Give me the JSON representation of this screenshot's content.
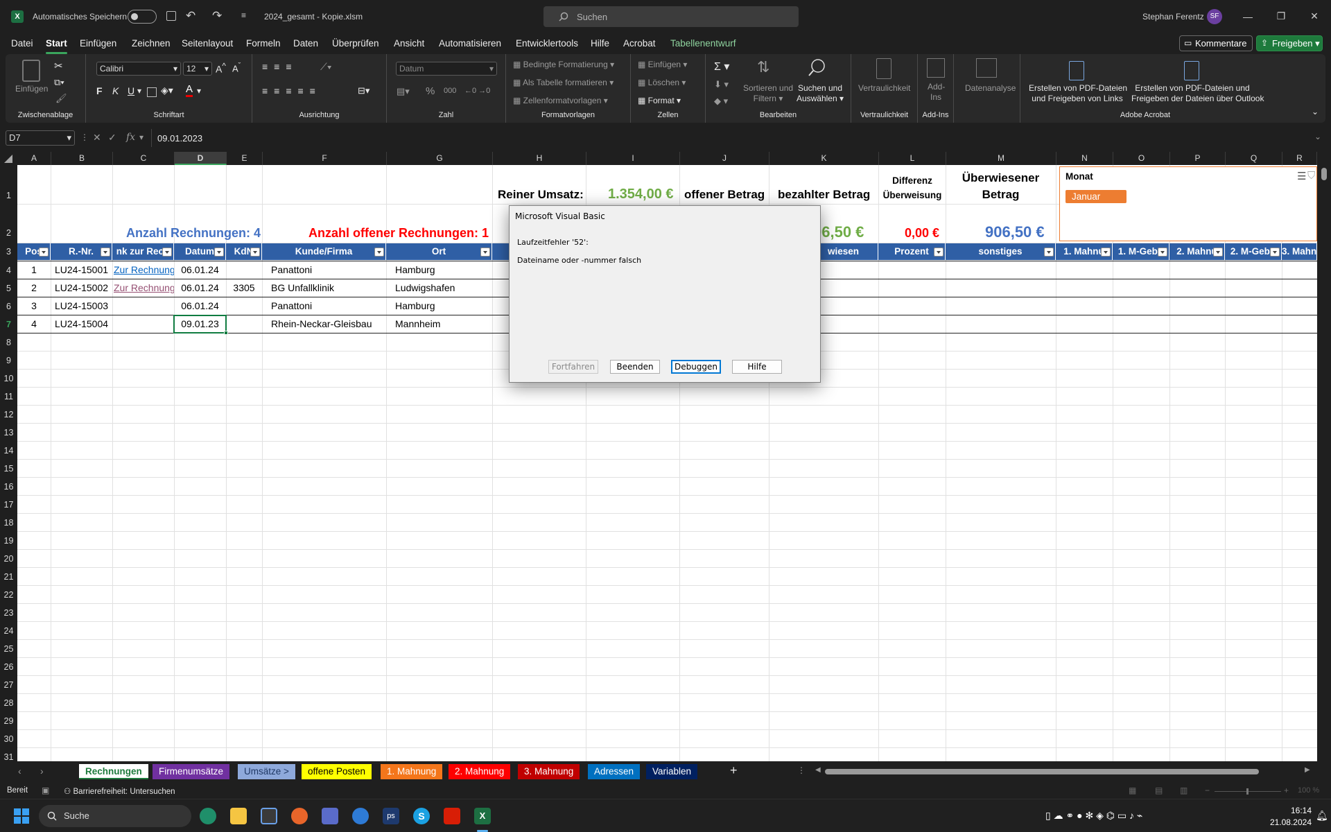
{
  "titlebar": {
    "autosave_label": "Automatisches Speichern",
    "filename": "2024_gesamt - Kopie.xlsm",
    "search_placeholder": "Suchen",
    "user_name": "Stephan Ferentz",
    "user_initials": "SF"
  },
  "menu": [
    "Datei",
    "Start",
    "Einfügen",
    "Zeichnen",
    "Seitenlayout",
    "Formeln",
    "Daten",
    "Überprüfen",
    "Ansicht",
    "Automatisieren",
    "Entwicklertools",
    "Hilfe",
    "Acrobat",
    "Tabellenentwurf"
  ],
  "menu_buttons": {
    "comment": "Kommentare",
    "share": "Freigeben"
  },
  "ribbon": {
    "paste": "Einfügen",
    "font_name": "Calibri",
    "font_size": "12",
    "bold": "F",
    "italic": "K",
    "underline": "U",
    "number_format": "Datum",
    "cond_format": "Bedingte Formatierung",
    "as_table": "Als Tabelle formatieren",
    "cell_styles": "Zellenformatvorlagen",
    "insert": "Einfügen",
    "delete": "Löschen",
    "format": "Format",
    "sort_filter": [
      "Sortieren und",
      "Filtern"
    ],
    "find": [
      "Suchen und",
      "Auswählen"
    ],
    "sensitivity": "Vertraulichkeit",
    "addins": [
      "Add-",
      "Ins"
    ],
    "analyze": "Datenanalyse",
    "pdf_links": [
      "Erstellen von PDF-Dateien",
      "und Freigeben von Links"
    ],
    "pdf_outlook": [
      "Erstellen von PDF-Dateien und",
      "Freigeben der Dateien über Outlook"
    ],
    "groups": [
      "Zwischenablage",
      "Schriftart",
      "Ausrichtung",
      "Zahl",
      "Formatvorlagen",
      "Zellen",
      "Bearbeiten",
      "Vertraulichkeit",
      "Add-Ins",
      "Adobe Acrobat"
    ]
  },
  "formula": {
    "name_box": "D7",
    "fx": "fx",
    "value": "09.01.2023"
  },
  "columns": [
    "A",
    "B",
    "C",
    "D",
    "E",
    "F",
    "G",
    "H",
    "I",
    "J",
    "K",
    "L",
    "M",
    "N",
    "O",
    "P",
    "Q",
    "R"
  ],
  "rows": [
    "1",
    "2",
    "3",
    "4",
    "5",
    "6",
    "7",
    "8",
    "9",
    "10",
    "11",
    "12",
    "13",
    "14",
    "15",
    "16",
    "17",
    "18",
    "19",
    "20",
    "21",
    "22",
    "23",
    "24",
    "25",
    "26",
    "27",
    "28",
    "29",
    "30",
    "31"
  ],
  "summary": {
    "umsatz_label": "Reiner Umsatz:",
    "umsatz_value": "1.354,00 €",
    "offen_label": "offener Betrag",
    "bezahlt_label": "bezahlter Betrag",
    "differenz_label": [
      "Differenz",
      "Überweisung"
    ],
    "ueberwiesen_label": [
      "Überwiesener",
      "Betrag"
    ],
    "anzahl": "Anzahl Rechnungen: 4",
    "anzahl_offen": "Anzahl offener Rechnungen: 1",
    "bezahlt_value": "06,50 €",
    "differenz_value": "0,00 €",
    "ueberwiesen_value": "906,50 €"
  },
  "table_headers": [
    "Pos",
    "R.-Nr.",
    "nk zur Rech",
    "Datum",
    "KdN",
    "Kunde/Firma",
    "Ort",
    "wiesen",
    "Prozent",
    "sonstiges",
    "1. Mahnu",
    "1. M-Gebü",
    "2. Mahnu",
    "2. M-Gebü",
    "3. Mahnu"
  ],
  "table_rows": [
    {
      "pos": "1",
      "nr": "LU24-15001",
      "link": "Zur Rechnung",
      "datum": "06.01.24",
      "kdn": "",
      "firma": "Panattoni",
      "ort": "Hamburg"
    },
    {
      "pos": "2",
      "nr": "LU24-15002",
      "link": "Zur Rechnung",
      "datum": "06.01.24",
      "kdn": "3305",
      "firma": "BG Unfallklinik",
      "ort": "Ludwigshafen"
    },
    {
      "pos": "3",
      "nr": "LU24-15003",
      "link": "",
      "datum": "06.01.24",
      "kdn": "",
      "firma": "Panattoni",
      "ort": "Hamburg"
    },
    {
      "pos": "4",
      "nr": "LU24-15004",
      "link": "",
      "datum": "09.01.23",
      "kdn": "",
      "firma": "Rhein-Neckar-Gleisbau",
      "ort": "Mannheim"
    }
  ],
  "slicer": {
    "title": "Monat",
    "item": "Januar"
  },
  "dialog": {
    "title": "Microsoft Visual Basic",
    "error": "Laufzeitfehler '52':",
    "message": "Dateiname oder -nummer falsch",
    "buttons": [
      "Fortfahren",
      "Beenden",
      "Debuggen",
      "Hilfe"
    ]
  },
  "sheet_tabs": [
    {
      "label": "Rechnungen",
      "bg": "#ffffff",
      "fg": "#1e7a3c"
    },
    {
      "label": "Firmenumsätze",
      "bg": "#7030a0",
      "fg": "#ffffff"
    },
    {
      "label": "Umsätze >",
      "bg": "#8ea9db",
      "fg": "#1f3864"
    },
    {
      "label": "offene Posten",
      "bg": "#ffff00",
      "fg": "#000000"
    },
    {
      "label": "1. Mahnung",
      "bg": "#f4761b",
      "fg": "#ffffff"
    },
    {
      "label": "2. Mahnung",
      "bg": "#ff0000",
      "fg": "#ffffff"
    },
    {
      "label": "3. Mahnung",
      "bg": "#c00000",
      "fg": "#ffffff"
    },
    {
      "label": "Adressen",
      "bg": "#0070c0",
      "fg": "#ffffff"
    },
    {
      "label": "Variablen",
      "bg": "#002060",
      "fg": "#ffffff"
    }
  ],
  "status": {
    "ready": "Bereit",
    "accessibility": "Barrierefreiheit: Untersuchen",
    "zoom": "100 %"
  },
  "taskbar": {
    "search": "Suche",
    "time": "16:14",
    "date": "21.08.2024"
  },
  "colors": {
    "header_blue": "#2f5fa5",
    "green": "#70ad47",
    "blue_text": "#4472c4",
    "red_text": "#ff0000",
    "orange": "#ed7d31",
    "ribbon_bg": "#292929"
  }
}
